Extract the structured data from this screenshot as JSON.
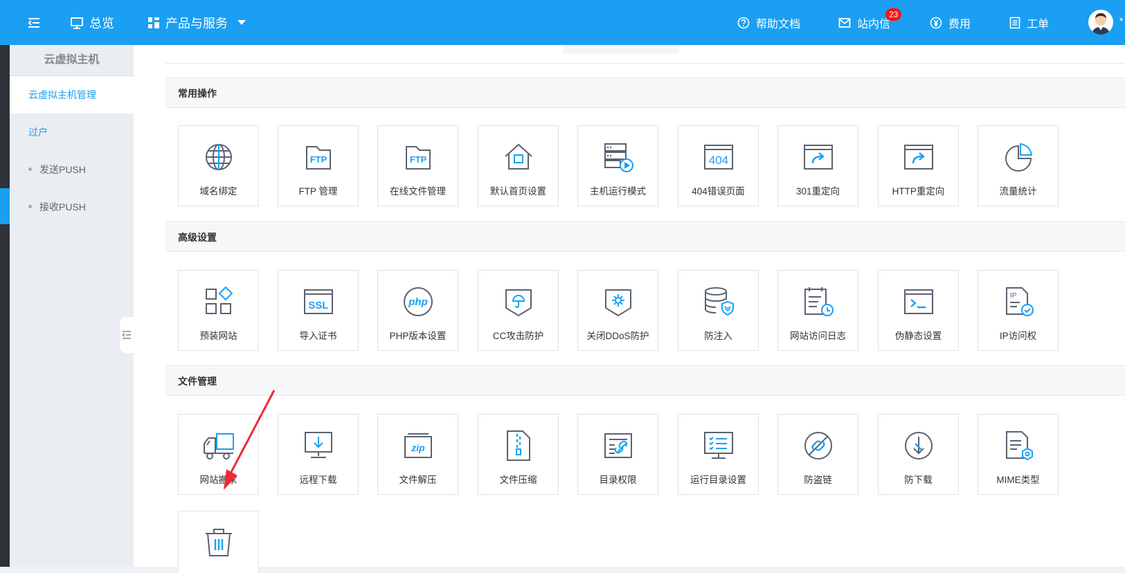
{
  "header": {
    "overview": "总览",
    "products": "产品与服务",
    "help": "帮助文档",
    "messages": "站内信",
    "messages_badge": "23",
    "billing": "费用",
    "tickets": "工单",
    "user_extra": "*"
  },
  "sidebar": {
    "title": "云虚拟主机",
    "items": [
      {
        "label": "云虚拟主机管理"
      },
      {
        "label": "过户"
      },
      {
        "label": "发送PUSH"
      },
      {
        "label": "接收PUSH"
      }
    ]
  },
  "sections": [
    {
      "title": "常用操作",
      "tiles": [
        {
          "label": "域名绑定",
          "icon": "globe-icon"
        },
        {
          "label": "FTP 管理",
          "icon": "ftp-folder-icon"
        },
        {
          "label": "在线文件管理",
          "icon": "ftp-folder-icon"
        },
        {
          "label": "默认首页设置",
          "icon": "home-icon"
        },
        {
          "label": "主机运行模式",
          "icon": "server-play-icon"
        },
        {
          "label": "404错误页面",
          "icon": "error-404-icon"
        },
        {
          "label": "301重定向",
          "icon": "redirect-icon"
        },
        {
          "label": "HTTP重定向",
          "icon": "redirect-icon"
        },
        {
          "label": "流量统计",
          "icon": "pie-chart-icon"
        }
      ]
    },
    {
      "title": "高级设置",
      "tiles": [
        {
          "label": "预装网站",
          "icon": "apps-icon"
        },
        {
          "label": "导入证书",
          "icon": "ssl-icon"
        },
        {
          "label": "PHP版本设置",
          "icon": "php-icon"
        },
        {
          "label": "CC攻击防护",
          "icon": "shield-umbrella-icon"
        },
        {
          "label": "关闭DDoS防护",
          "icon": "shield-gear-icon"
        },
        {
          "label": "防注入",
          "icon": "database-shield-icon"
        },
        {
          "label": "网站访问日志",
          "icon": "log-clock-icon"
        },
        {
          "label": "伪静态设置",
          "icon": "terminal-icon"
        },
        {
          "label": "IP访问权",
          "icon": "ip-check-icon"
        }
      ]
    },
    {
      "title": "文件管理",
      "tiles": [
        {
          "label": "网站搬家",
          "icon": "truck-icon"
        },
        {
          "label": "远程下载",
          "icon": "monitor-download-icon"
        },
        {
          "label": "文件解压",
          "icon": "zip-folder-icon"
        },
        {
          "label": "文件压缩",
          "icon": "file-zip-icon"
        },
        {
          "label": "目录权限",
          "icon": "directory-link-icon"
        },
        {
          "label": "运行目录设置",
          "icon": "monitor-list-icon"
        },
        {
          "label": "防盗链",
          "icon": "broken-link-icon"
        },
        {
          "label": "防下载",
          "icon": "no-download-icon"
        },
        {
          "label": "MIME类型",
          "icon": "file-gear-icon"
        },
        {
          "label": "",
          "icon": "trash-icon"
        }
      ]
    }
  ],
  "colors": {
    "accent": "#1a9ff2",
    "icon_gray": "#5a6270",
    "arrow": "#f0283c"
  }
}
